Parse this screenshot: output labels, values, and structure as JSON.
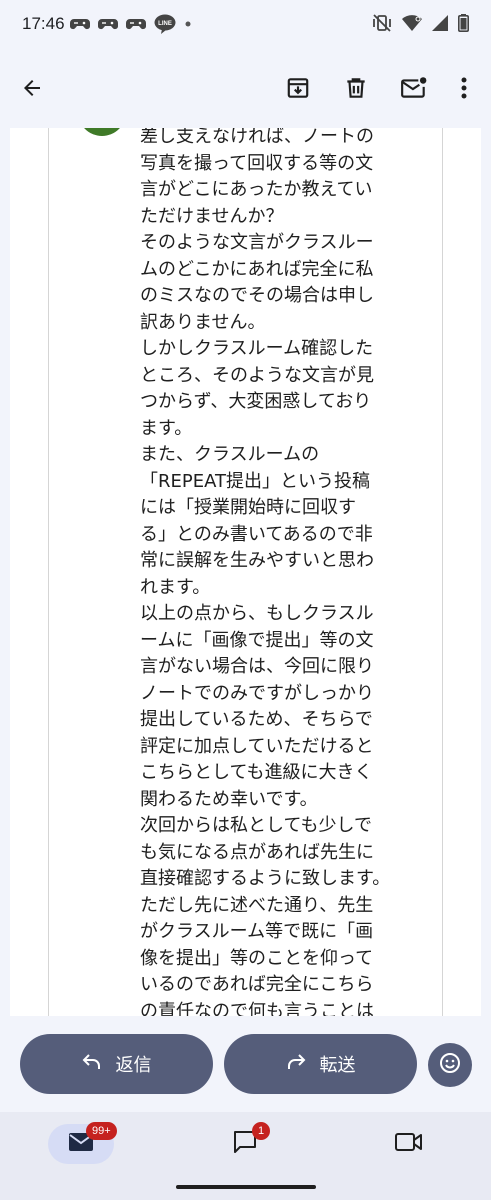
{
  "status_bar": {
    "time": "17:46",
    "left_icons": [
      "game-controller-icon",
      "game-controller-icon",
      "game-controller-icon",
      "line-app-icon",
      "dot-icon"
    ],
    "line_label": "LINE",
    "right_icons": [
      "vibrate-off-icon",
      "wifi-icon",
      "signal-icon",
      "battery-icon"
    ]
  },
  "app_bar": {
    "icons": [
      "back-arrow-icon",
      "archive-icon",
      "delete-icon",
      "mark-unread-icon",
      "more-vert-icon"
    ]
  },
  "message": {
    "body": "差し支えなければ、ノートの\n写真を撮って回収する等の文\n言がどこにあったか教えてい\nただけませんか？\nそのような文言がクラスルー\nムのどこかにあれば完全に私\nのミスなのでその場合は申し\n訳ありません。\nしかしクラスルーム確認した\nところ、そのような文言が見\nつからず、大変困惑しており\nます。\nまた、クラスルームの\n「REPEAT提出」という投稿\nには「授業開始時に回収す\nる」とのみ書いてあるので非\n常に誤解を生みやすいと思わ\nれます。\n以上の点から、もしクラスル\nームに「画像で提出」等の文\n言がない場合は、今回に限り\nノートでのみですがしっかり\n提出しているため、そちらで\n評定に加点していただけると\nこちらとしても進級に大きく\n関わるため幸いです。\n次回からは私としても少しで\nも気になる点があれば先生に\n直接確認するように致します。\nただし先に述べた通り、先生\nがクラスルーム等で既に「画\n像を提出」等のことを仰って\nいるのであれば完全にこちら\nの責任なので何も言うことは\nありません。"
  },
  "actions": {
    "reply_label": "返信",
    "forward_label": "転送"
  },
  "bottom_nav": {
    "mail_badge": "99+",
    "chat_badge": "1"
  },
  "colors": {
    "accent": "#555d7a",
    "badge": "#c5221f",
    "avatar": "#3f7a28",
    "background": "#f2f4fb"
  }
}
